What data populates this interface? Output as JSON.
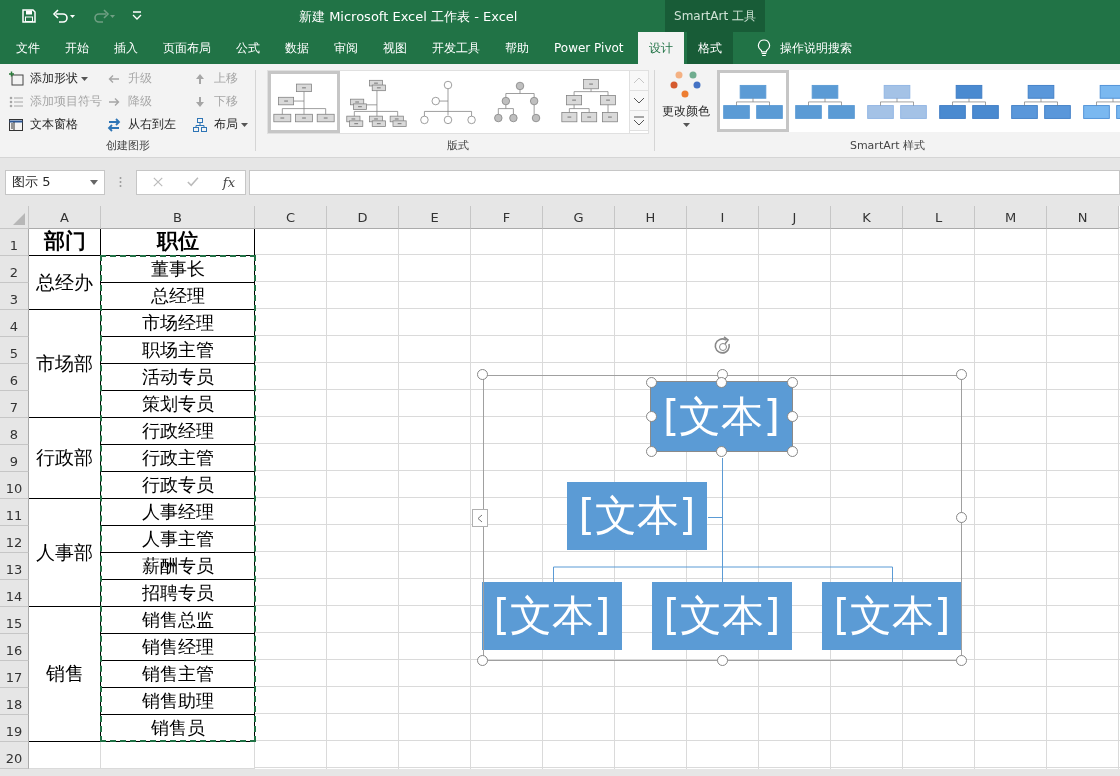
{
  "window": {
    "title": "新建 Microsoft Excel 工作表  -  Excel"
  },
  "context_tab_group": {
    "label": "SmartArt 工具"
  },
  "menu_tabs": [
    {
      "label": "文件",
      "selected": false,
      "contextual": false
    },
    {
      "label": "开始",
      "selected": false,
      "contextual": false
    },
    {
      "label": "插入",
      "selected": false,
      "contextual": false
    },
    {
      "label": "页面布局",
      "selected": false,
      "contextual": false
    },
    {
      "label": "公式",
      "selected": false,
      "contextual": false
    },
    {
      "label": "数据",
      "selected": false,
      "contextual": false
    },
    {
      "label": "审阅",
      "selected": false,
      "contextual": false
    },
    {
      "label": "视图",
      "selected": false,
      "contextual": false
    },
    {
      "label": "开发工具",
      "selected": false,
      "contextual": false
    },
    {
      "label": "帮助",
      "selected": false,
      "contextual": false
    },
    {
      "label": "Power Pivot",
      "selected": false,
      "contextual": false
    },
    {
      "label": "设计",
      "selected": true,
      "contextual": true
    },
    {
      "label": "格式",
      "selected": false,
      "contextual": true
    }
  ],
  "tell_me": {
    "label": "操作说明搜索"
  },
  "ribbon": {
    "create_graphic": {
      "label": "创建图形",
      "commands": [
        {
          "label": "添加形状",
          "disabled": false,
          "dropdown": true
        },
        {
          "label": "升级",
          "disabled": true,
          "dropdown": false
        },
        {
          "label": "上移",
          "disabled": true,
          "dropdown": false
        },
        {
          "label": "添加项目符号",
          "disabled": true,
          "dropdown": false
        },
        {
          "label": "降级",
          "disabled": true,
          "dropdown": false
        },
        {
          "label": "下移",
          "disabled": true,
          "dropdown": false
        },
        {
          "label": "文本窗格",
          "disabled": false,
          "dropdown": false
        },
        {
          "label": "从右到左",
          "disabled": false,
          "dropdown": false
        },
        {
          "label": "布局",
          "disabled": false,
          "dropdown": true
        }
      ]
    },
    "layouts": {
      "label": "版式",
      "options": [
        {
          "selected": true
        },
        {
          "selected": false
        },
        {
          "selected": false
        },
        {
          "selected": false
        },
        {
          "selected": false
        }
      ]
    },
    "change_colors": {
      "label": "更改颜色"
    },
    "styles": {
      "label": "SmartArt 样式",
      "options": [
        {
          "selected": true
        },
        {
          "selected": false
        },
        {
          "selected": false
        },
        {
          "selected": false
        },
        {
          "selected": false
        },
        {
          "selected": false
        }
      ]
    }
  },
  "formula_bar": {
    "name_box": "图示 5",
    "function_label": "fx"
  },
  "sheet": {
    "columns": [
      "A",
      "B",
      "C",
      "D",
      "E",
      "F",
      "G",
      "H",
      "I",
      "J",
      "K",
      "L",
      "M",
      "N"
    ],
    "rows": [
      "1",
      "2",
      "3",
      "4",
      "5",
      "6",
      "7",
      "8",
      "9",
      "10",
      "11",
      "12",
      "13",
      "14",
      "15",
      "16",
      "17",
      "18",
      "19",
      "20"
    ],
    "header": [
      "部门",
      "职位"
    ],
    "marquee": true,
    "departments": [
      {
        "name": "总经办",
        "titles": [
          "董事长",
          "总经理"
        ]
      },
      {
        "name": "市场部",
        "titles": [
          "市场经理",
          "职场主管",
          "活动专员",
          "策划专员"
        ]
      },
      {
        "name": "行政部",
        "titles": [
          "行政经理",
          "行政主管",
          "行政专员"
        ]
      },
      {
        "name": "人事部",
        "titles": [
          "人事经理",
          "人事主管",
          "薪酬专员",
          "招聘专员"
        ]
      },
      {
        "name": "销售",
        "titles": [
          "销售总监",
          "销售经理",
          "销售主管",
          "销售助理",
          "销售员"
        ]
      }
    ]
  },
  "smartart": {
    "nodes": [
      {
        "text": "[文本]",
        "kind": "top",
        "selected": true
      },
      {
        "text": "[文本]",
        "kind": "assistant",
        "selected": false
      },
      {
        "text": "[文本]",
        "kind": "child",
        "selected": false
      },
      {
        "text": "[文本]",
        "kind": "child",
        "selected": false
      },
      {
        "text": "[文本]",
        "kind": "child",
        "selected": false
      }
    ]
  }
}
